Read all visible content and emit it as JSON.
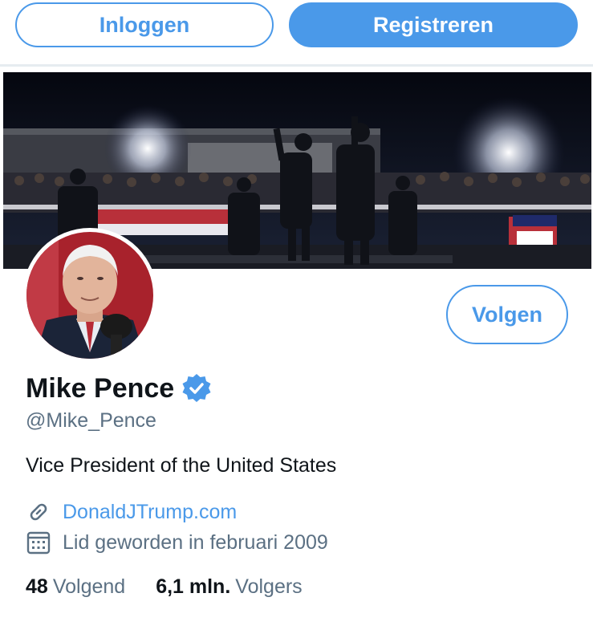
{
  "header": {
    "login_label": "Inloggen",
    "register_label": "Registreren"
  },
  "profile": {
    "name": "Mike Pence",
    "handle": "@Mike_Pence",
    "bio": "Vice President of the United States",
    "website": "DonaldJTrump.com",
    "joined": "Lid geworden in februari 2009",
    "follow_label": "Volgen",
    "following_count": "48",
    "following_label": "Volgend",
    "followers_count": "6,1 mln.",
    "followers_label": "Volgers",
    "verified": true
  },
  "icons": {
    "verified": "verified-badge-icon",
    "link": "link-icon",
    "calendar": "calendar-icon"
  },
  "colors": {
    "accent": "#4a99e9",
    "text_primary": "#0f1419",
    "text_secondary": "#5b7083"
  }
}
